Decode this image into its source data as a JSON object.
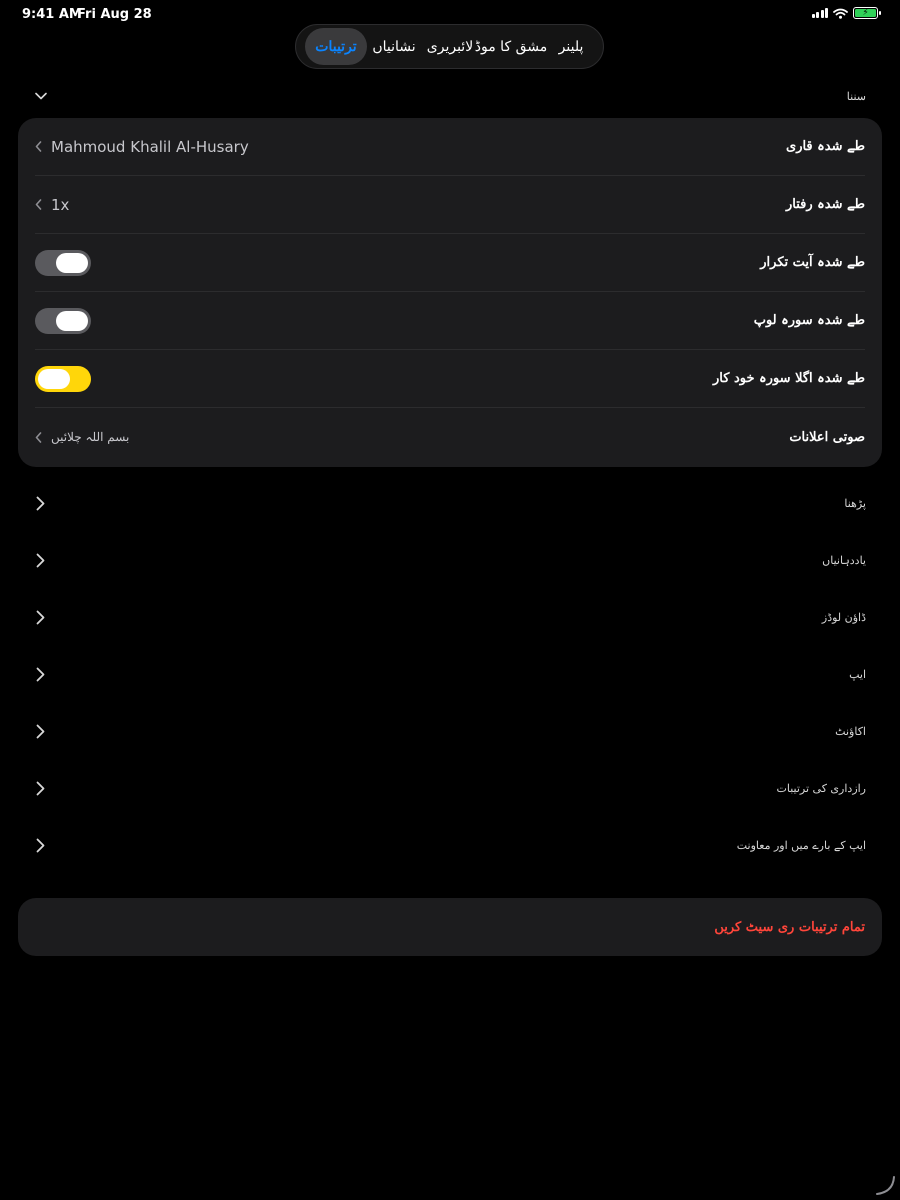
{
  "status_bar": {
    "time": "9:41 AM",
    "date": "Fri Aug 28",
    "icons": [
      "cellular-signal-icon",
      "wifi-icon",
      "battery-charging-icon"
    ],
    "battery_color": "#30d158"
  },
  "tabs": {
    "items": [
      {
        "label": "پلینر",
        "active": false
      },
      {
        "label": "مشق کا موڈ",
        "active": false
      },
      {
        "label": "لائبریری",
        "active": false
      },
      {
        "label": "نشانیاں",
        "active": false
      },
      {
        "label": "ترتیبات",
        "active": true
      }
    ],
    "active_color": "#0a84ff"
  },
  "listening": {
    "header": "سننا",
    "expanded": true,
    "rows": {
      "reciter": {
        "label": "طے شدہ قاری",
        "value": "Mahmoud Khalil Al-Husary"
      },
      "speed": {
        "label": "طے شدہ رفتار",
        "value": "1x"
      },
      "verse_repeat": {
        "label": "طے شدہ آیت تکرار",
        "enabled": false
      },
      "surah_loop": {
        "label": "طے شدہ سورہ لوپ",
        "enabled": false
      },
      "autoplay_next": {
        "label": "طے شدہ اگلا سورہ خود کار",
        "enabled": true
      },
      "audio_announcements": {
        "label": "صوتی اعلانات",
        "value": "بسم اللہ چلائیں"
      }
    },
    "toggle_on_color": "#ffd60a"
  },
  "sections": [
    {
      "label": "پڑھنا"
    },
    {
      "label": "یاددہانیاں"
    },
    {
      "label": "ڈاؤن لوڈز"
    },
    {
      "label": "ایپ"
    },
    {
      "label": "اکاؤنٹ"
    },
    {
      "label": "رازداری کی ترتیبات"
    },
    {
      "label": "ایپ کے بارے میں اور معاونت"
    }
  ],
  "reset": {
    "label": "تمام ترتیبات ری سیٹ کریں",
    "color": "#ff453a"
  }
}
